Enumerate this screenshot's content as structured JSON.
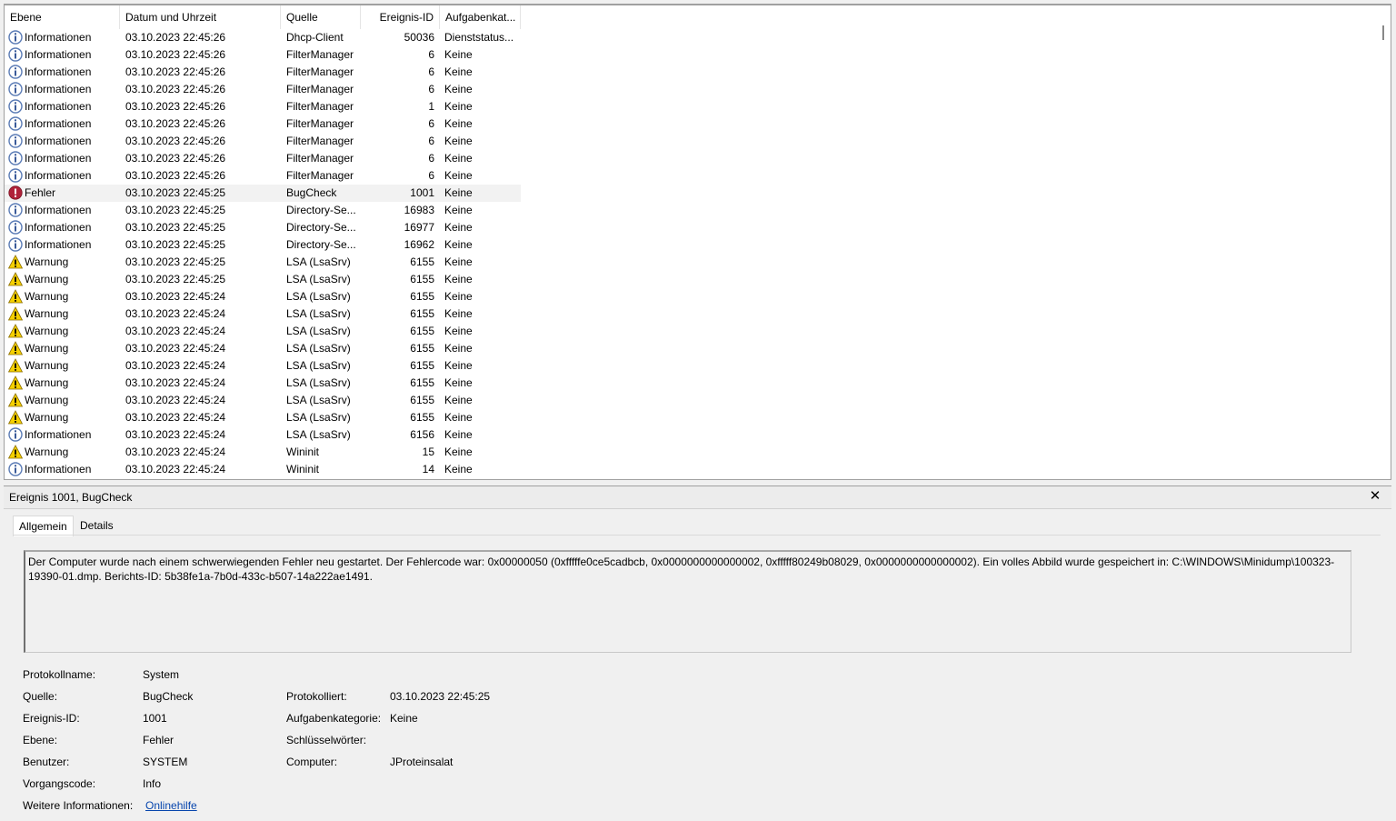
{
  "columns": {
    "level": "Ebene",
    "date": "Datum und Uhrzeit",
    "source": "Quelle",
    "event_id": "Ereignis-ID",
    "category": "Aufgabenkat..."
  },
  "events": [
    {
      "type": "info",
      "level": "Informationen",
      "date": "03.10.2023 22:45:26",
      "source": "Dhcp-Client",
      "id": "50036",
      "category": "Dienststatus..."
    },
    {
      "type": "info",
      "level": "Informationen",
      "date": "03.10.2023 22:45:26",
      "source": "FilterManager",
      "id": "6",
      "category": "Keine"
    },
    {
      "type": "info",
      "level": "Informationen",
      "date": "03.10.2023 22:45:26",
      "source": "FilterManager",
      "id": "6",
      "category": "Keine"
    },
    {
      "type": "info",
      "level": "Informationen",
      "date": "03.10.2023 22:45:26",
      "source": "FilterManager",
      "id": "6",
      "category": "Keine"
    },
    {
      "type": "info",
      "level": "Informationen",
      "date": "03.10.2023 22:45:26",
      "source": "FilterManager",
      "id": "1",
      "category": "Keine"
    },
    {
      "type": "info",
      "level": "Informationen",
      "date": "03.10.2023 22:45:26",
      "source": "FilterManager",
      "id": "6",
      "category": "Keine"
    },
    {
      "type": "info",
      "level": "Informationen",
      "date": "03.10.2023 22:45:26",
      "source": "FilterManager",
      "id": "6",
      "category": "Keine"
    },
    {
      "type": "info",
      "level": "Informationen",
      "date": "03.10.2023 22:45:26",
      "source": "FilterManager",
      "id": "6",
      "category": "Keine"
    },
    {
      "type": "info",
      "level": "Informationen",
      "date": "03.10.2023 22:45:26",
      "source": "FilterManager",
      "id": "6",
      "category": "Keine"
    },
    {
      "type": "error",
      "level": "Fehler",
      "date": "03.10.2023 22:45:25",
      "source": "BugCheck",
      "id": "1001",
      "category": "Keine",
      "selected": true
    },
    {
      "type": "info",
      "level": "Informationen",
      "date": "03.10.2023 22:45:25",
      "source": "Directory-Se...",
      "id": "16983",
      "category": "Keine"
    },
    {
      "type": "info",
      "level": "Informationen",
      "date": "03.10.2023 22:45:25",
      "source": "Directory-Se...",
      "id": "16977",
      "category": "Keine"
    },
    {
      "type": "info",
      "level": "Informationen",
      "date": "03.10.2023 22:45:25",
      "source": "Directory-Se...",
      "id": "16962",
      "category": "Keine"
    },
    {
      "type": "warning",
      "level": "Warnung",
      "date": "03.10.2023 22:45:25",
      "source": "LSA (LsaSrv)",
      "id": "6155",
      "category": "Keine"
    },
    {
      "type": "warning",
      "level": "Warnung",
      "date": "03.10.2023 22:45:25",
      "source": "LSA (LsaSrv)",
      "id": "6155",
      "category": "Keine"
    },
    {
      "type": "warning",
      "level": "Warnung",
      "date": "03.10.2023 22:45:24",
      "source": "LSA (LsaSrv)",
      "id": "6155",
      "category": "Keine"
    },
    {
      "type": "warning",
      "level": "Warnung",
      "date": "03.10.2023 22:45:24",
      "source": "LSA (LsaSrv)",
      "id": "6155",
      "category": "Keine"
    },
    {
      "type": "warning",
      "level": "Warnung",
      "date": "03.10.2023 22:45:24",
      "source": "LSA (LsaSrv)",
      "id": "6155",
      "category": "Keine"
    },
    {
      "type": "warning",
      "level": "Warnung",
      "date": "03.10.2023 22:45:24",
      "source": "LSA (LsaSrv)",
      "id": "6155",
      "category": "Keine"
    },
    {
      "type": "warning",
      "level": "Warnung",
      "date": "03.10.2023 22:45:24",
      "source": "LSA (LsaSrv)",
      "id": "6155",
      "category": "Keine"
    },
    {
      "type": "warning",
      "level": "Warnung",
      "date": "03.10.2023 22:45:24",
      "source": "LSA (LsaSrv)",
      "id": "6155",
      "category": "Keine"
    },
    {
      "type": "warning",
      "level": "Warnung",
      "date": "03.10.2023 22:45:24",
      "source": "LSA (LsaSrv)",
      "id": "6155",
      "category": "Keine"
    },
    {
      "type": "warning",
      "level": "Warnung",
      "date": "03.10.2023 22:45:24",
      "source": "LSA (LsaSrv)",
      "id": "6155",
      "category": "Keine"
    },
    {
      "type": "info",
      "level": "Informationen",
      "date": "03.10.2023 22:45:24",
      "source": "LSA (LsaSrv)",
      "id": "6156",
      "category": "Keine"
    },
    {
      "type": "warning",
      "level": "Warnung",
      "date": "03.10.2023 22:45:24",
      "source": "Wininit",
      "id": "15",
      "category": "Keine"
    },
    {
      "type": "info",
      "level": "Informationen",
      "date": "03.10.2023 22:45:24",
      "source": "Wininit",
      "id": "14",
      "category": "Keine"
    }
  ],
  "detail": {
    "title": "Ereignis 1001, BugCheck",
    "tabs": {
      "general": "Allgemein",
      "details": "Details"
    },
    "message": "Der Computer wurde nach einem schwerwiegenden Fehler neu gestartet. Der Fehlercode war: 0x00000050 (0xfffffe0ce5cadbcb, 0x0000000000000002, 0xfffff80249b08029, 0x0000000000000002). Ein volles Abbild wurde gespeichert in: C:\\WINDOWS\\Minidump\\100323-19390-01.dmp. Berichts-ID: 5b38fe1a-7b0d-433c-b507-14a222ae1491.",
    "labels": {
      "log_name": "Protokollname:",
      "source": "Quelle:",
      "event_id": "Ereignis-ID:",
      "level": "Ebene:",
      "user": "Benutzer:",
      "opcode": "Vorgangscode:",
      "more_info": "Weitere Informationen:",
      "logged": "Protokolliert:",
      "task_category": "Aufgabenkategorie:",
      "keywords": "Schlüsselwörter:",
      "computer": "Computer:"
    },
    "values": {
      "log_name": "System",
      "source": "BugCheck",
      "event_id": "1001",
      "level": "Fehler",
      "user": "SYSTEM",
      "opcode": "Info",
      "more_info": "Onlinehilfe",
      "logged": "03.10.2023 22:45:25",
      "task_category": "Keine",
      "keywords": "",
      "computer": "JProteinsalat"
    }
  },
  "colors": {
    "info_icon": "#5a7bb5",
    "error_icon": "#b0223a",
    "warning_icon": "#f5d000",
    "link": "#0645ad"
  }
}
